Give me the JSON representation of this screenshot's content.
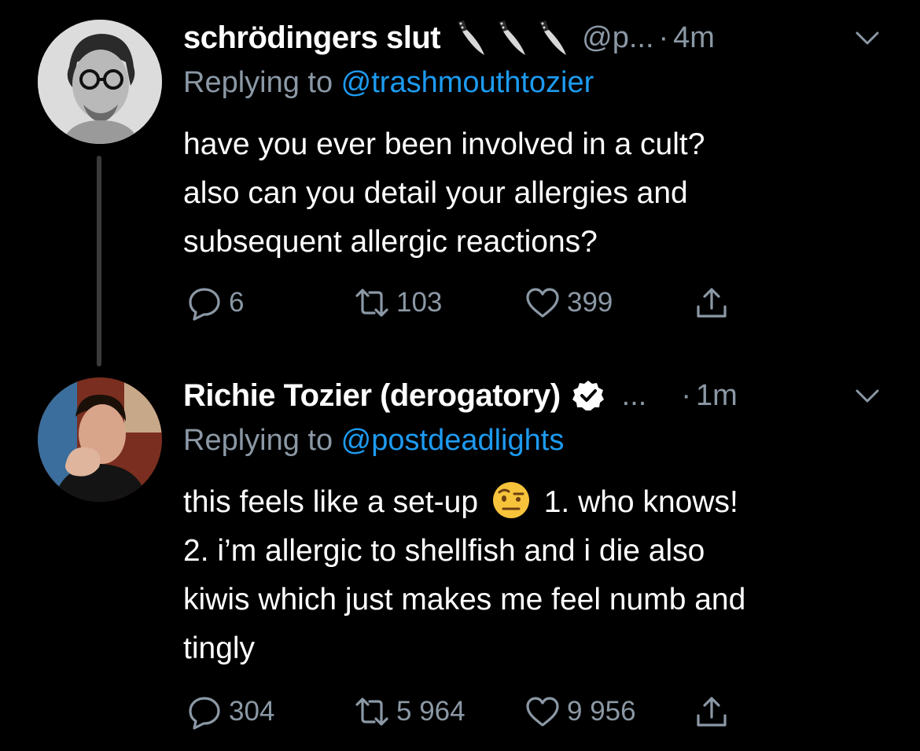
{
  "tweets": [
    {
      "display_name": "schrödingers slut",
      "name_icons": [
        "knife-icon",
        "knife-icon",
        "knife-icon"
      ],
      "handle": "@p...",
      "dot": "·",
      "time": "4m",
      "replying_prefix": "Replying to ",
      "replying_handle": "@trashmouthtozier",
      "body_lines": [
        "have you ever been involved in a cult?",
        "also can you detail your allergies and",
        "subsequent allergic reactions?"
      ],
      "counts": {
        "replies": "6",
        "retweets": "103",
        "likes": "399"
      }
    },
    {
      "display_name": "Richie Tozier (derogatory)",
      "verified": true,
      "handle": "...",
      "dot": "·",
      "time": "1m",
      "replying_prefix": "Replying to ",
      "replying_handle": "@postdeadlights",
      "body_line1_before_emoji": "this feels like a set-up",
      "body_line1_after_emoji": "1. who knows!",
      "body_lines_rest": [
        "2. i’m allergic to shellfish and i die also",
        "kiwis which just makes me feel numb and",
        "tingly"
      ],
      "counts": {
        "replies": "304",
        "retweets": "5 964",
        "likes": "9 956"
      }
    }
  ],
  "colors": {
    "background": "#000000",
    "text": "#ffffff",
    "secondary": "#8b98a5",
    "link": "#1d9bf0",
    "thread_line": "#3a3a3a"
  }
}
